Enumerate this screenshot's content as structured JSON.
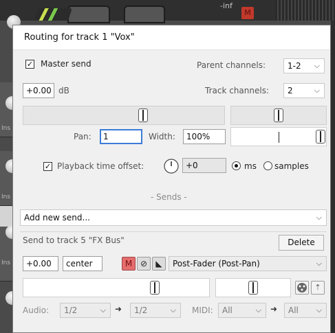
{
  "background": {
    "meter_text": "-inf",
    "mute_label": "M",
    "ins_labels": [
      "Ins",
      "Ins",
      "Ins"
    ]
  },
  "dialog": {
    "title": "Routing for track 1 \"Vox\"",
    "master_send": {
      "label": "Master send",
      "checked": true
    },
    "parent_channels": {
      "label": "Parent channels:",
      "value": "1-2"
    },
    "volume": {
      "value": "+0.00",
      "unit": "dB"
    },
    "track_channels": {
      "label": "Track channels:",
      "value": "2"
    },
    "volume_level": 0.6,
    "pan_knob_level": 0.5,
    "pan": {
      "label": "Pan:",
      "value": "1"
    },
    "width": {
      "label": "Width:",
      "value": "100%"
    },
    "width_level": 1.0,
    "playback_offset": {
      "label": "Playback time offset:",
      "value": "+0",
      "checked": true
    },
    "units": {
      "ms": "ms",
      "samples": "samples",
      "selected": "ms"
    },
    "sends_header": "- Sends -",
    "add_send": {
      "value": "Add new send..."
    },
    "send": {
      "title": "Send to track 5 \"FX Bus\"",
      "delete_label": "Delete",
      "volume": "+0.00",
      "pan": "center",
      "mute_label": "M",
      "mode": "Post-Fader (Post-Pan)",
      "volume_level": 0.72,
      "pan_level": 0.5,
      "audio_label": "Audio:",
      "audio_src": "1/2",
      "audio_dst": "1/2",
      "midi_label": "MIDI:",
      "midi_src": "All",
      "midi_dst": "All"
    }
  }
}
